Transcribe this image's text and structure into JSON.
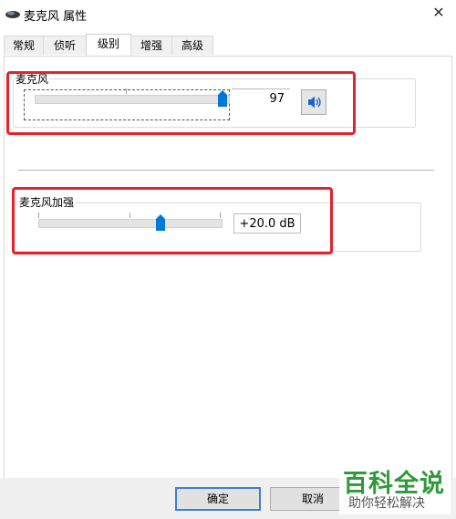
{
  "window": {
    "title": "麦克风 属性",
    "close_glyph": "✕"
  },
  "tabs": [
    {
      "label": "常规",
      "active": false
    },
    {
      "label": "侦听",
      "active": false
    },
    {
      "label": "级别",
      "active": true
    },
    {
      "label": "增强",
      "active": false
    },
    {
      "label": "高级",
      "active": false
    }
  ],
  "microphone": {
    "label": "麦克风",
    "value_text": "97",
    "level": 97,
    "speaker_icon": "speaker-icon"
  },
  "boost": {
    "label": "麦克风加强",
    "value_text": "+20.0 dB",
    "level_fraction": 0.67
  },
  "buttons": {
    "ok": "确定",
    "cancel": "取消"
  },
  "watermark": {
    "title": "百科全说",
    "subtitle": "助你轻松解决"
  },
  "colors": {
    "accent": "#0078d7",
    "highlight": "#e8202a",
    "watermark": "#2e9a3c"
  }
}
